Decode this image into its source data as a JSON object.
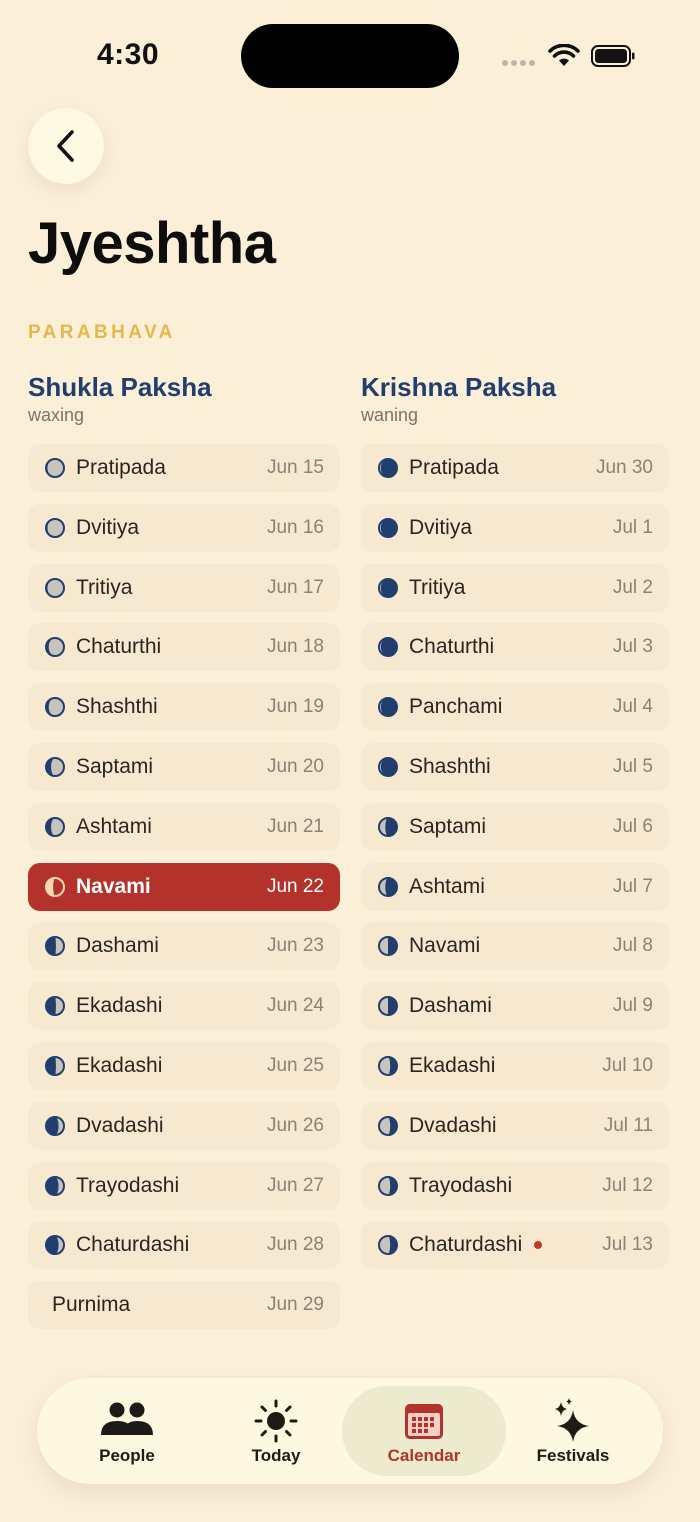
{
  "status": {
    "time": "4:30"
  },
  "header": {
    "title": "Jyeshtha",
    "year_name": "PARABHAVA"
  },
  "shukla": {
    "title": "Shukla Paksha",
    "subtitle": "waxing",
    "rows": [
      {
        "name": "Pratipada",
        "date": "Jun 15",
        "moon": "waxing-1"
      },
      {
        "name": "Dvitiya",
        "date": "Jun 16",
        "moon": "waxing-1"
      },
      {
        "name": "Tritiya",
        "date": "Jun 17",
        "moon": "waxing-1"
      },
      {
        "name": "Chaturthi",
        "date": "Jun 18",
        "moon": "waxing-2"
      },
      {
        "name": "Shashthi",
        "date": "Jun 19",
        "moon": "waxing-2"
      },
      {
        "name": "Saptami",
        "date": "Jun 20",
        "moon": "waxing-3"
      },
      {
        "name": "Ashtami",
        "date": "Jun 21",
        "moon": "waxing-3"
      },
      {
        "name": "Navami",
        "date": "Jun 22",
        "moon": "waxing-4",
        "selected": true
      },
      {
        "name": "Dashami",
        "date": "Jun 23",
        "moon": "waxing-5"
      },
      {
        "name": "Ekadashi",
        "date": "Jun 24",
        "moon": "waxing-5"
      },
      {
        "name": "Ekadashi",
        "date": "Jun 25",
        "moon": "waxing-5"
      },
      {
        "name": "Dvadashi",
        "date": "Jun 26",
        "moon": "waxing-6"
      },
      {
        "name": "Trayodashi",
        "date": "Jun 27",
        "moon": "waxing-6"
      },
      {
        "name": "Chaturdashi",
        "date": "Jun 28",
        "moon": "waxing-6"
      },
      {
        "name": "Purnima",
        "date": "Jun 29",
        "moon": "none"
      }
    ]
  },
  "krishna": {
    "title": "Krishna Paksha",
    "subtitle": "waning",
    "rows": [
      {
        "name": "Pratipada",
        "date": "Jun 30",
        "moon": "waning-1"
      },
      {
        "name": "Dvitiya",
        "date": "Jul 1",
        "moon": "waning-1"
      },
      {
        "name": "Tritiya",
        "date": "Jul 2",
        "moon": "waning-1"
      },
      {
        "name": "Chaturthi",
        "date": "Jul 3",
        "moon": "waning-1"
      },
      {
        "name": "Panchami",
        "date": "Jul 4",
        "moon": "waning-1"
      },
      {
        "name": "Shashthi",
        "date": "Jul 5",
        "moon": "waning-1"
      },
      {
        "name": "Saptami",
        "date": "Jul 6",
        "moon": "waning-2"
      },
      {
        "name": "Ashtami",
        "date": "Jul 7",
        "moon": "waning-2"
      },
      {
        "name": "Navami",
        "date": "Jul 8",
        "moon": "waning-3"
      },
      {
        "name": "Dashami",
        "date": "Jul 9",
        "moon": "waning-3"
      },
      {
        "name": "Ekadashi",
        "date": "Jul 10",
        "moon": "waning-4"
      },
      {
        "name": "Dvadashi",
        "date": "Jul 11",
        "moon": "waning-4"
      },
      {
        "name": "Trayodashi",
        "date": "Jul 12",
        "moon": "waning-4"
      },
      {
        "name": "Chaturdashi",
        "date": "Jul 13",
        "moon": "waning-4",
        "marker": true
      }
    ]
  },
  "tabs": [
    {
      "label": "People",
      "icon": "people-icon"
    },
    {
      "label": "Today",
      "icon": "sun-icon"
    },
    {
      "label": "Calendar",
      "icon": "calendar-icon",
      "active": true
    },
    {
      "label": "Festivals",
      "icon": "sparkles-icon"
    }
  ],
  "colors": {
    "background": "#fbefd8",
    "accent": "#b3322b",
    "paksha_title": "#213e6e",
    "year_label": "#e2b94a",
    "moon_dark": "#213e6e",
    "moon_light": "#c9c4bb"
  }
}
